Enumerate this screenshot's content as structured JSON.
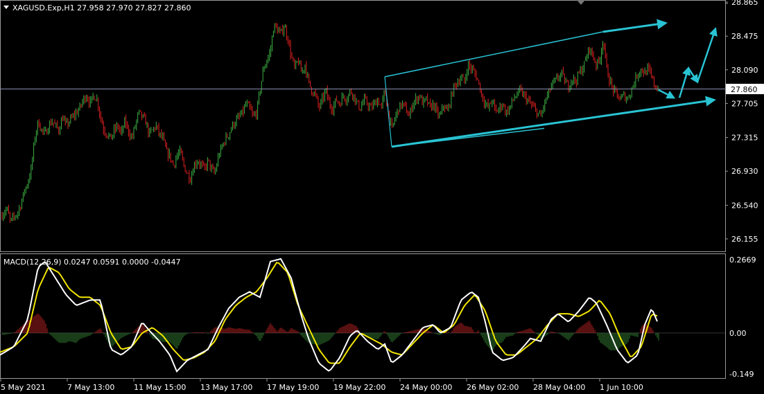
{
  "header": {
    "symbol_info": "XAGUSD.Exp,H1  27.958 27.970 27.827 27.860"
  },
  "indicator": {
    "label": "MACD(12,26,9) 0.0247 0.0591 0.0000 -0.0447"
  },
  "price_axis": {
    "ticks": [
      "28.865",
      "28.475",
      "28.090",
      "27.705",
      "27.315",
      "26.930",
      "26.540",
      "26.155"
    ],
    "current_price": "27.860"
  },
  "macd_axis": {
    "ticks": [
      "0.2669",
      "0.00",
      "-0.149"
    ]
  },
  "time_axis": {
    "ticks": [
      "5 May 2021",
      "7 May 13:00",
      "11 May 15:00",
      "13 May 17:00",
      "17 May 19:00",
      "19 May 22:00",
      "24 May 00:00",
      "26 May 02:00",
      "28 May 04:00",
      "1 Jun 10:00"
    ]
  },
  "colors": {
    "background": "#000000",
    "bull_candle": "#3cb043",
    "bear_candle": "#e02020",
    "channel": "#29c4d4",
    "macd_line": "#ffffff",
    "signal_line": "#f2e600",
    "hist_positive": "#b02020",
    "hist_negative": "#2f7a2f",
    "price_line": "#8a8fb0"
  },
  "chart_data": {
    "type": "candlestick",
    "symbol": "XAGUSD.Exp",
    "timeframe": "H1",
    "last_bar": {
      "open": 27.958,
      "high": 27.97,
      "low": 27.827,
      "close": 27.86
    },
    "y_range": [
      26.05,
      28.9
    ],
    "x_ticks": [
      "5 May 2021",
      "7 May 13:00",
      "11 May 15:00",
      "13 May 17:00",
      "17 May 19:00",
      "19 May 22:00",
      "24 May 00:00",
      "26 May 02:00",
      "28 May 04:00",
      "1 Jun 10:00"
    ],
    "price_path": [
      [
        0,
        26.4
      ],
      [
        5,
        26.45
      ],
      [
        10,
        26.5
      ],
      [
        15,
        26.35
      ],
      [
        20,
        26.4
      ],
      [
        25,
        26.45
      ],
      [
        30,
        26.55
      ],
      [
        35,
        26.7
      ],
      [
        40,
        26.8
      ],
      [
        45,
        26.95
      ],
      [
        50,
        27.3
      ],
      [
        55,
        27.5
      ],
      [
        60,
        27.4
      ],
      [
        65,
        27.35
      ],
      [
        70,
        27.45
      ],
      [
        75,
        27.5
      ],
      [
        80,
        27.45
      ],
      [
        85,
        27.4
      ],
      [
        90,
        27.55
      ],
      [
        95,
        27.45
      ],
      [
        100,
        27.5
      ],
      [
        105,
        27.55
      ],
      [
        110,
        27.6
      ],
      [
        115,
        27.65
      ],
      [
        120,
        27.75
      ],
      [
        125,
        27.8
      ],
      [
        130,
        27.7
      ],
      [
        135,
        27.8
      ],
      [
        140,
        27.75
      ],
      [
        145,
        27.55
      ],
      [
        150,
        27.4
      ],
      [
        155,
        27.35
      ],
      [
        160,
        27.3
      ],
      [
        165,
        27.4
      ],
      [
        170,
        27.45
      ],
      [
        175,
        27.35
      ],
      [
        180,
        27.5
      ],
      [
        185,
        27.4
      ],
      [
        190,
        27.3
      ],
      [
        195,
        27.45
      ],
      [
        200,
        27.6
      ],
      [
        205,
        27.55
      ],
      [
        210,
        27.5
      ],
      [
        215,
        27.35
      ],
      [
        220,
        27.4
      ],
      [
        225,
        27.45
      ],
      [
        230,
        27.35
      ],
      [
        235,
        27.3
      ],
      [
        240,
        27.15
      ],
      [
        245,
        27.1
      ],
      [
        250,
        27.0
      ],
      [
        255,
        27.1
      ],
      [
        260,
        27.15
      ],
      [
        265,
        27.0
      ],
      [
        270,
        26.9
      ],
      [
        275,
        26.85
      ],
      [
        280,
        27.0
      ],
      [
        285,
        27.05
      ],
      [
        290,
        27.0
      ],
      [
        295,
        26.95
      ],
      [
        300,
        27.05
      ],
      [
        305,
        26.95
      ],
      [
        310,
        26.9
      ],
      [
        315,
        27.1
      ],
      [
        320,
        27.2
      ],
      [
        325,
        27.3
      ],
      [
        330,
        27.35
      ],
      [
        335,
        27.45
      ],
      [
        340,
        27.5
      ],
      [
        345,
        27.55
      ],
      [
        350,
        27.6
      ],
      [
        355,
        27.7
      ],
      [
        360,
        27.65
      ],
      [
        365,
        27.55
      ],
      [
        370,
        27.6
      ],
      [
        375,
        27.85
      ],
      [
        380,
        28.1
      ],
      [
        385,
        28.2
      ],
      [
        390,
        28.3
      ],
      [
        395,
        28.6
      ],
      [
        400,
        28.55
      ],
      [
        405,
        28.5
      ],
      [
        410,
        28.6
      ],
      [
        415,
        28.45
      ],
      [
        420,
        28.25
      ],
      [
        425,
        28.1
      ],
      [
        430,
        28.2
      ],
      [
        435,
        28.05
      ],
      [
        440,
        28.15
      ],
      [
        445,
        27.95
      ],
      [
        450,
        27.85
      ],
      [
        455,
        27.8
      ],
      [
        460,
        27.65
      ],
      [
        465,
        27.75
      ],
      [
        470,
        27.85
      ],
      [
        475,
        27.7
      ],
      [
        480,
        27.65
      ],
      [
        485,
        27.75
      ],
      [
        490,
        27.7
      ],
      [
        495,
        27.8
      ],
      [
        500,
        27.75
      ],
      [
        505,
        27.85
      ],
      [
        510,
        27.8
      ],
      [
        515,
        27.7
      ],
      [
        520,
        27.65
      ],
      [
        525,
        27.75
      ],
      [
        530,
        27.7
      ],
      [
        535,
        27.65
      ],
      [
        540,
        27.7
      ],
      [
        545,
        27.75
      ],
      [
        550,
        27.65
      ],
      [
        555,
        27.85
      ],
      [
        560,
        27.6
      ],
      [
        565,
        27.4
      ],
      [
        570,
        27.55
      ],
      [
        575,
        27.65
      ],
      [
        580,
        27.7
      ],
      [
        585,
        27.65
      ],
      [
        590,
        27.55
      ],
      [
        595,
        27.7
      ],
      [
        600,
        27.75
      ],
      [
        605,
        27.8
      ],
      [
        610,
        27.7
      ],
      [
        615,
        27.75
      ],
      [
        620,
        27.65
      ],
      [
        625,
        27.7
      ],
      [
        630,
        27.6
      ],
      [
        635,
        27.55
      ],
      [
        640,
        27.7
      ],
      [
        645,
        27.6
      ],
      [
        650,
        27.75
      ],
      [
        655,
        27.9
      ],
      [
        660,
        27.95
      ],
      [
        665,
        28.0
      ],
      [
        670,
        27.95
      ],
      [
        675,
        28.15
      ],
      [
        680,
        28.1
      ],
      [
        685,
        28.05
      ],
      [
        690,
        27.95
      ],
      [
        695,
        27.8
      ],
      [
        700,
        27.7
      ],
      [
        705,
        27.65
      ],
      [
        710,
        27.75
      ],
      [
        715,
        27.6
      ],
      [
        720,
        27.65
      ],
      [
        725,
        27.7
      ],
      [
        730,
        27.6
      ],
      [
        735,
        27.65
      ],
      [
        740,
        27.75
      ],
      [
        745,
        27.8
      ],
      [
        750,
        27.85
      ],
      [
        755,
        27.8
      ],
      [
        760,
        27.75
      ],
      [
        765,
        27.7
      ],
      [
        770,
        27.65
      ],
      [
        775,
        27.6
      ],
      [
        780,
        27.55
      ],
      [
        785,
        27.7
      ],
      [
        790,
        27.8
      ],
      [
        795,
        27.9
      ],
      [
        800,
        27.95
      ],
      [
        805,
        28.0
      ],
      [
        810,
        28.05
      ],
      [
        815,
        27.95
      ],
      [
        820,
        27.9
      ],
      [
        825,
        28.0
      ],
      [
        830,
        27.95
      ],
      [
        835,
        28.05
      ],
      [
        840,
        28.1
      ],
      [
        845,
        28.2
      ],
      [
        850,
        28.35
      ],
      [
        855,
        28.25
      ],
      [
        860,
        28.15
      ],
      [
        865,
        28.2
      ],
      [
        870,
        28.45
      ],
      [
        875,
        28.1
      ],
      [
        880,
        27.95
      ],
      [
        885,
        27.85
      ],
      [
        890,
        27.8
      ],
      [
        895,
        27.75
      ],
      [
        900,
        27.8
      ],
      [
        905,
        27.75
      ],
      [
        910,
        27.85
      ],
      [
        915,
        27.95
      ],
      [
        920,
        28.05
      ],
      [
        925,
        28.1
      ],
      [
        930,
        28.05
      ],
      [
        935,
        28.1
      ],
      [
        940,
        28.0
      ],
      [
        945,
        27.9
      ],
      [
        950,
        27.86
      ]
    ],
    "channel": {
      "upper": [
        [
          555,
          28.01
        ],
        [
          870,
          28.525
        ]
      ],
      "lower": [
        [
          565,
          27.21
        ],
        [
          785,
          27.42
        ]
      ]
    },
    "macd_path": [
      [
        0,
        -0.08
      ],
      [
        20,
        -0.05
      ],
      [
        40,
        0.05
      ],
      [
        55,
        0.24
      ],
      [
        65,
        0.26
      ],
      [
        80,
        0.2
      ],
      [
        95,
        0.14
      ],
      [
        110,
        0.1
      ],
      [
        130,
        0.12
      ],
      [
        145,
        0.12
      ],
      [
        160,
        -0.06
      ],
      [
        175,
        -0.08
      ],
      [
        190,
        -0.05
      ],
      [
        205,
        0.04
      ],
      [
        215,
        0.01
      ],
      [
        230,
        -0.03
      ],
      [
        245,
        -0.08
      ],
      [
        255,
        -0.14
      ],
      [
        270,
        -0.1
      ],
      [
        285,
        -0.08
      ],
      [
        300,
        -0.06
      ],
      [
        315,
        0.02
      ],
      [
        330,
        0.09
      ],
      [
        345,
        0.13
      ],
      [
        360,
        0.15
      ],
      [
        375,
        0.13
      ],
      [
        390,
        0.26
      ],
      [
        405,
        0.27
      ],
      [
        420,
        0.2
      ],
      [
        435,
        0.06
      ],
      [
        445,
        -0.02
      ],
      [
        460,
        -0.11
      ],
      [
        475,
        -0.14
      ],
      [
        490,
        -0.09
      ],
      [
        505,
        -0.01
      ],
      [
        515,
        0.01
      ],
      [
        530,
        -0.03
      ],
      [
        545,
        -0.06
      ],
      [
        555,
        -0.04
      ],
      [
        565,
        -0.11
      ],
      [
        580,
        -0.08
      ],
      [
        595,
        -0.03
      ],
      [
        610,
        0.02
      ],
      [
        625,
        0.03
      ],
      [
        635,
        0.0
      ],
      [
        650,
        0.02
      ],
      [
        665,
        0.12
      ],
      [
        680,
        0.15
      ],
      [
        690,
        0.13
      ],
      [
        700,
        0.04
      ],
      [
        710,
        -0.07
      ],
      [
        725,
        -0.1
      ],
      [
        740,
        -0.09
      ],
      [
        755,
        -0.05
      ],
      [
        765,
        -0.02
      ],
      [
        780,
        -0.03
      ],
      [
        795,
        0.05
      ],
      [
        805,
        0.07
      ],
      [
        820,
        0.04
      ],
      [
        835,
        0.08
      ],
      [
        850,
        0.13
      ],
      [
        860,
        0.11
      ],
      [
        875,
        0.03
      ],
      [
        890,
        -0.06
      ],
      [
        905,
        -0.11
      ],
      [
        920,
        -0.08
      ],
      [
        930,
        0.03
      ],
      [
        940,
        0.09
      ],
      [
        950,
        0.03
      ]
    ],
    "signal_path": [
      [
        0,
        -0.07
      ],
      [
        20,
        -0.05
      ],
      [
        40,
        0.0
      ],
      [
        55,
        0.16
      ],
      [
        70,
        0.24
      ],
      [
        85,
        0.22
      ],
      [
        100,
        0.16
      ],
      [
        115,
        0.13
      ],
      [
        130,
        0.13
      ],
      [
        145,
        0.1
      ],
      [
        160,
        0.0
      ],
      [
        175,
        -0.06
      ],
      [
        190,
        -0.05
      ],
      [
        205,
        0.0
      ],
      [
        220,
        0.02
      ],
      [
        235,
        -0.01
      ],
      [
        250,
        -0.06
      ],
      [
        265,
        -0.1
      ],
      [
        280,
        -0.09
      ],
      [
        295,
        -0.07
      ],
      [
        310,
        -0.03
      ],
      [
        325,
        0.05
      ],
      [
        340,
        0.1
      ],
      [
        355,
        0.13
      ],
      [
        370,
        0.15
      ],
      [
        385,
        0.2
      ],
      [
        400,
        0.26
      ],
      [
        415,
        0.22
      ],
      [
        430,
        0.1
      ],
      [
        445,
        0.02
      ],
      [
        460,
        -0.06
      ],
      [
        475,
        -0.11
      ],
      [
        490,
        -0.11
      ],
      [
        505,
        -0.05
      ],
      [
        520,
        0.0
      ],
      [
        535,
        -0.02
      ],
      [
        550,
        -0.04
      ],
      [
        565,
        -0.07
      ],
      [
        580,
        -0.08
      ],
      [
        595,
        -0.04
      ],
      [
        610,
        0.0
      ],
      [
        625,
        0.03
      ],
      [
        640,
        0.0
      ],
      [
        655,
        0.03
      ],
      [
        670,
        0.1
      ],
      [
        685,
        0.14
      ],
      [
        700,
        0.08
      ],
      [
        715,
        -0.03
      ],
      [
        730,
        -0.08
      ],
      [
        745,
        -0.08
      ],
      [
        760,
        -0.05
      ],
      [
        775,
        -0.02
      ],
      [
        790,
        0.03
      ],
      [
        805,
        0.07
      ],
      [
        820,
        0.07
      ],
      [
        835,
        0.06
      ],
      [
        850,
        0.08
      ],
      [
        865,
        0.12
      ],
      [
        880,
        0.07
      ],
      [
        895,
        -0.02
      ],
      [
        910,
        -0.09
      ],
      [
        925,
        -0.05
      ],
      [
        940,
        0.07
      ],
      [
        950,
        0.06
      ]
    ],
    "macd_range": [
      -0.149,
      0.2669
    ],
    "forecast_arrows": [
      [
        [
          870,
          28.525
        ],
        [
          960,
          28.625
        ]
      ],
      [
        [
          565,
          27.21
        ],
        [
          1030,
          27.745
        ]
      ],
      [
        [
          950,
          27.86
        ],
        [
          972,
          27.77
        ]
      ],
      [
        [
          980,
          27.77
        ],
        [
          993,
          28.11
        ]
      ],
      [
        [
          993,
          28.11
        ],
        [
          1006,
          27.95
        ]
      ],
      [
        [
          1006,
          27.95
        ],
        [
          1032,
          28.56
        ]
      ]
    ]
  }
}
